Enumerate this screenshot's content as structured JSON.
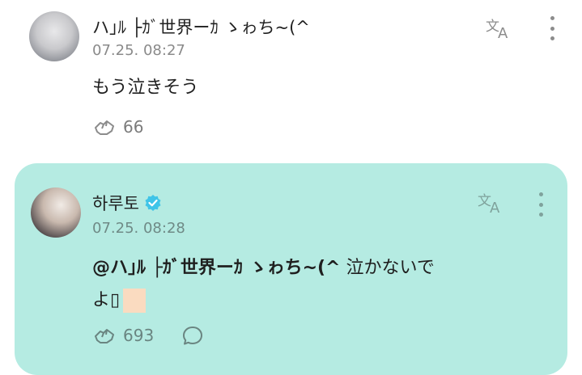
{
  "comments": [
    {
      "username": "ハ｣ﾙ ├ｶﾞ世界ーｶ ゝゎち~(^",
      "timestamp": "07.25. 08:27",
      "body": "もう泣きそう",
      "likes": "66"
    }
  ],
  "reply": {
    "username": "하루토",
    "verified": true,
    "timestamp": "07.25. 08:28",
    "mention": "@ハ｣ﾙ ├ｶﾞ世界ーｶ ゝゎち~(^",
    "body_line1": " 泣かないで",
    "body_line2": "よ▯",
    "likes": "693",
    "highlight_color": "#b5ebe2"
  },
  "icons": {
    "translate": "translate-icon",
    "more": "more-vertical-icon",
    "like": "like-paw-icon",
    "comment": "comment-bubble-icon",
    "verified": "verified-badge-icon"
  }
}
